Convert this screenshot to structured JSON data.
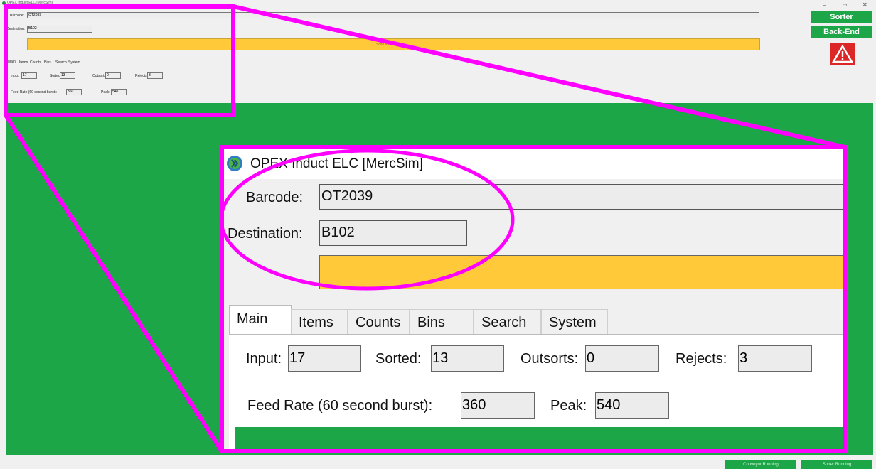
{
  "window": {
    "title": "OPEX Induct ELC [MercSim]",
    "controls": [
      "–",
      "▭",
      "✕"
    ]
  },
  "side_buttons": {
    "sorter": "Sorter",
    "backend": "Back-End"
  },
  "form": {
    "barcode_label": "Barcode:",
    "barcode_value": "OT2039",
    "destination_label": "Destination:",
    "destination_value": "B102",
    "status_banner_small": "Scan a barcode"
  },
  "tabs": [
    "Main",
    "Items",
    "Counts",
    "Bins",
    "Search",
    "System"
  ],
  "counts": {
    "input_label": "Input:",
    "input_value": "17",
    "sorted_label": "Sorted:",
    "sorted_value": "13",
    "outsorts_label": "Outsorts:",
    "outsorts_value": "0",
    "rejects_label": "Rejects:",
    "rejects_value": "3",
    "feed_label": "Feed Rate (60 second burst):",
    "feed_value": "360",
    "peak_label": "Peak:",
    "peak_value": "540"
  },
  "status_bar": {
    "conveyor": "Conveyor Running",
    "sorter": "Sorter Running"
  },
  "colors": {
    "green": "#1da648",
    "yellow": "#ffc93a",
    "highlight": "#ff00ff",
    "alert_red": "#dd2626"
  }
}
